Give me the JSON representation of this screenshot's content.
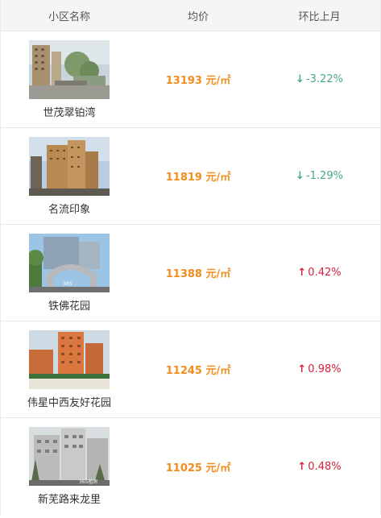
{
  "header": {
    "col_name": "小区名称",
    "col_price": "均价",
    "col_change": "环比上月"
  },
  "price_unit": "元/㎡",
  "rows": [
    {
      "name": "世茂翠铂湾",
      "price": "13193",
      "change": "-3.22%",
      "direction": "down",
      "arrow": "↓"
    },
    {
      "name": "名流印象",
      "price": "11819",
      "change": "-1.29%",
      "direction": "down",
      "arrow": "↓"
    },
    {
      "name": "铁佛花园",
      "price": "11388",
      "change": "0.42%",
      "direction": "up",
      "arrow": "↑"
    },
    {
      "name": "伟星中西友好花园",
      "price": "11245",
      "change": "0.98%",
      "direction": "up",
      "arrow": "↑"
    },
    {
      "name": "新芜路来龙里",
      "price": "11025",
      "change": "0.48%",
      "direction": "up",
      "arrow": "↑"
    }
  ],
  "photo_watermarks": {
    "row_2": "365",
    "row_4": "365租房"
  },
  "colors": {
    "price": "#f28c1d",
    "down": "#4aa588",
    "up": "#d0243b",
    "header_bg": "#f5f5f5"
  }
}
